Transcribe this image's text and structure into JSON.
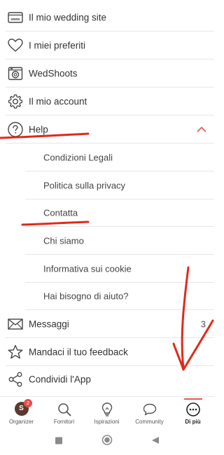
{
  "menu": {
    "items": [
      {
        "label": "Il mio wedding site",
        "icon": "www-icon"
      },
      {
        "label": "I miei preferiti",
        "icon": "heart-icon"
      },
      {
        "label": "WedShoots",
        "icon": "camera-icon"
      },
      {
        "label": "Il mio account",
        "icon": "gear-icon"
      },
      {
        "label": "Help",
        "icon": "question-icon",
        "expanded": true
      }
    ],
    "help_subitems": [
      {
        "label": "Condizioni Legali"
      },
      {
        "label": "Politica sulla privacy"
      },
      {
        "label": "Contatta"
      },
      {
        "label": "Chi siamo"
      },
      {
        "label": "Informativa sui cookie"
      },
      {
        "label": "Hai bisogno di aiuto?"
      }
    ],
    "bottom_items": [
      {
        "label": "Messaggi",
        "icon": "mail-icon",
        "count": "3"
      },
      {
        "label": "Mandaci il tuo feedback",
        "icon": "star-icon"
      },
      {
        "label": "Condividi l'App",
        "icon": "share-icon"
      }
    ]
  },
  "bottom_nav": {
    "items": [
      {
        "label": "Organizer",
        "icon": "avatar",
        "avatar_initial": "S",
        "badge": "2"
      },
      {
        "label": "Fornitori",
        "icon": "search-icon"
      },
      {
        "label": "Ispirazioni",
        "icon": "lightbulb-icon"
      },
      {
        "label": "Community",
        "icon": "chat-bubble-icon"
      },
      {
        "label": "Di più",
        "icon": "more-icon",
        "active": true
      }
    ]
  },
  "colors": {
    "accent": "#e05a50",
    "annotation": "#e02a1a",
    "icon": "#444444",
    "separator": "#e6e6e6"
  }
}
